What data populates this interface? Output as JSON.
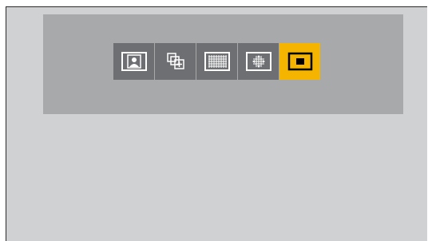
{
  "colors": {
    "page_background": "#ffffff",
    "screen_background": "#d0d1d3",
    "screen_border": "#2b2b2b",
    "menu_panel_background": "#a8a9ab",
    "button_background": "#6e6f72",
    "button_selected_background": "#f5b400",
    "icon_stroke_light": "#ffffff",
    "icon_stroke_selected": "#000000"
  },
  "af_modes": [
    {
      "id": "face-eye-detection",
      "icon": "face-detection-icon",
      "selected": false
    },
    {
      "id": "tracking",
      "icon": "tracking-icon",
      "selected": false
    },
    {
      "id": "multi-area",
      "icon": "multi-area-grid-icon",
      "selected": false
    },
    {
      "id": "custom-multi",
      "icon": "custom-multi-icon",
      "selected": false
    },
    {
      "id": "single-area",
      "icon": "single-area-icon",
      "selected": true
    }
  ]
}
